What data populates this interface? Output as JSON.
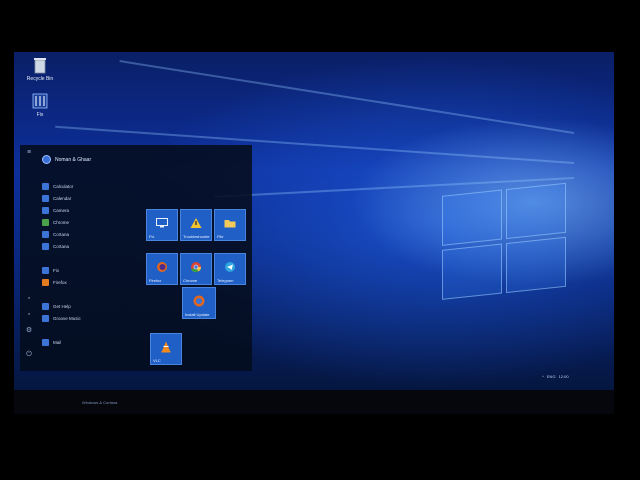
{
  "desktop": {
    "icons": [
      {
        "label": "Recycle Bin",
        "icon": "recycle-bin-icon"
      },
      {
        "label": "Fix",
        "icon": "fix-app-icon"
      }
    ]
  },
  "start_menu": {
    "user_name": "Noman & Ghaar",
    "apps": [
      {
        "label": "Calculator",
        "color": "#3b73d6"
      },
      {
        "label": "Calendar",
        "color": "#3b73d6"
      },
      {
        "label": "Camera",
        "color": "#3b73d6"
      },
      {
        "label": "Chrome",
        "color": "#4aa14a"
      },
      {
        "label": "Cortana",
        "color": "#3b73d6"
      },
      {
        "label": "Cortana",
        "color": "#3b73d6"
      },
      {
        "label": "Fix",
        "color": "#3b73d6"
      },
      {
        "label": "Firefox",
        "color": "#e07b1f"
      },
      {
        "label": "Get Help",
        "color": "#3b73d6"
      },
      {
        "label": "Groove Music",
        "color": "#3b73d6"
      },
      {
        "label": "Mail",
        "color": "#3b73d6"
      }
    ],
    "tiles": [
      {
        "label": "Fix",
        "glyph": "monitor-icon"
      },
      {
        "label": "Troubleshooter",
        "glyph": "warning-icon"
      },
      {
        "label": "File",
        "glyph": "folder-icon"
      },
      {
        "label": "Firefox",
        "glyph": "firefox-icon"
      },
      {
        "label": "Chrome",
        "glyph": "chrome-icon"
      },
      {
        "label": "Telegram",
        "glyph": "telegram-icon"
      },
      {
        "label": "Install Update",
        "glyph": "update-icon"
      },
      {
        "label": "VLC",
        "glyph": "vlc-icon"
      }
    ],
    "search_placeholder": "Windows & Cortana"
  },
  "taskbar": {
    "tray": [
      "^",
      "ENG",
      "12:00"
    ]
  }
}
